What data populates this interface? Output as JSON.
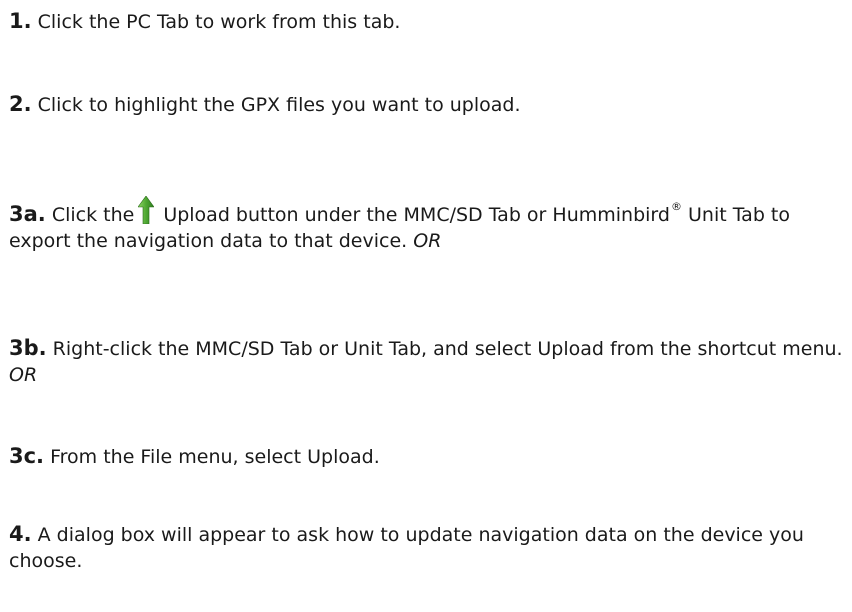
{
  "steps": [
    {
      "number": "1.",
      "text": "Click the PC Tab to work from this tab."
    },
    {
      "number": "2.",
      "text": "Click to highlight the GPX files you want to upload."
    },
    {
      "number": "3a.",
      "text_before_icon": "Click the",
      "icon": "upload-arrow-icon",
      "text_after_icon": "Upload button under the MMC/SD Tab or Humminbird",
      "registered_mark": "®",
      "text_after_mark": "Unit Tab to export the navigation data to that device.",
      "or_label": "OR"
    },
    {
      "number": "3b.",
      "text": "Right-click the MMC/SD Tab or Unit Tab, and select Upload from the shortcut menu.",
      "or_label": "OR"
    },
    {
      "number": "3c.",
      "text": "From the File menu, select Upload."
    },
    {
      "number": "4.",
      "text": "A dialog box will appear to ask how to update navigation data on the device you choose."
    }
  ],
  "colors": {
    "text": "#1a1a1a",
    "icon_green_light": "#6fc24a",
    "icon_green_dark": "#2e7d1f",
    "background": "#ffffff"
  }
}
